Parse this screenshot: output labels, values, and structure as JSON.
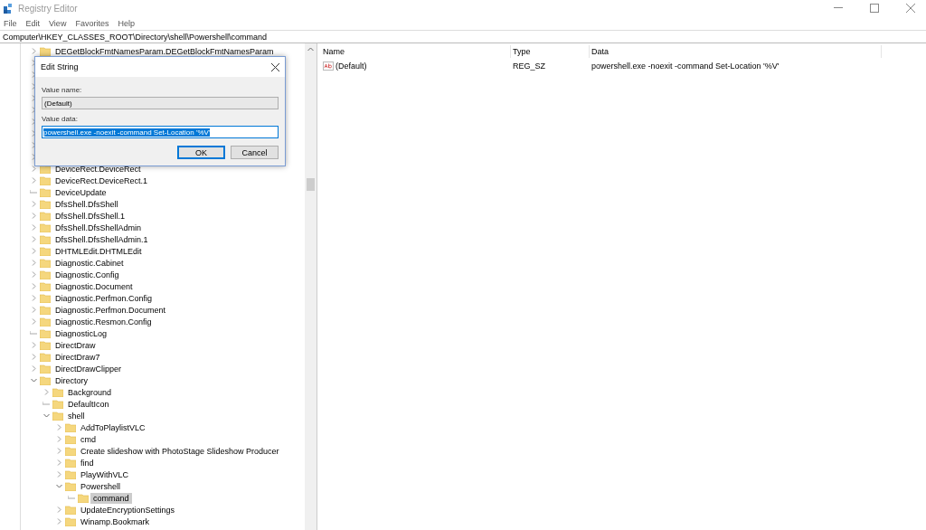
{
  "window": {
    "title": "Registry Editor"
  },
  "menu": [
    "File",
    "Edit",
    "View",
    "Favorites",
    "Help"
  ],
  "address": "Computer\\HKEY_CLASSES_ROOT\\Directory\\shell\\Powershell\\command",
  "tree": [
    {
      "label": "DEGetBlockFmtNamesParam.DEGetBlockFmtNamesParam",
      "kind": "collapsed",
      "selected": false
    },
    {
      "kind": "collapsed"
    },
    {
      "kind": "collapsed"
    },
    {
      "kind": "collapsed"
    },
    {
      "kind": "collapsed"
    },
    {
      "kind": "collapsed"
    },
    {
      "kind": "collapsed"
    },
    {
      "kind": "collapsed"
    },
    {
      "kind": "collapsed"
    },
    {
      "kind": "collapsed"
    },
    {
      "label": "DeviceRect.DeviceRect",
      "kind": "collapsed",
      "selected": false
    },
    {
      "label": "DeviceRect.DeviceRect.1",
      "kind": "collapsed",
      "selected": false
    },
    {
      "label": "DeviceUpdate",
      "kind": "leaf",
      "selected": false
    },
    {
      "label": "DfsShell.DfsShell",
      "kind": "collapsed",
      "selected": false
    },
    {
      "label": "DfsShell.DfsShell.1",
      "kind": "collapsed",
      "selected": false
    },
    {
      "label": "DfsShell.DfsShellAdmin",
      "kind": "collapsed",
      "selected": false
    },
    {
      "label": "DfsShell.DfsShellAdmin.1",
      "kind": "collapsed",
      "selected": false
    },
    {
      "label": "DHTMLEdit.DHTMLEdit",
      "kind": "collapsed",
      "selected": false
    },
    {
      "label": "Diagnostic.Cabinet",
      "kind": "collapsed",
      "selected": false
    },
    {
      "label": "Diagnostic.Config",
      "kind": "collapsed",
      "selected": false
    },
    {
      "label": "Diagnostic.Document",
      "kind": "collapsed",
      "selected": false
    },
    {
      "label": "Diagnostic.Perfmon.Config",
      "kind": "collapsed",
      "selected": false
    },
    {
      "label": "Diagnostic.Perfmon.Document",
      "kind": "collapsed",
      "selected": false
    },
    {
      "label": "Diagnostic.Resmon.Config",
      "kind": "collapsed",
      "selected": false
    },
    {
      "label": "DiagnosticLog",
      "kind": "leaf",
      "selected": false
    },
    {
      "label": "DirectDraw",
      "kind": "collapsed",
      "selected": false
    },
    {
      "label": "DirectDraw7",
      "kind": "collapsed",
      "selected": false
    },
    {
      "label": "DirectDrawClipper",
      "kind": "collapsed",
      "selected": false
    },
    {
      "label": "Directory",
      "kind": "expanded",
      "selected": false,
      "children": [
        {
          "label": "Background",
          "kind": "collapsed",
          "selected": false
        },
        {
          "label": "DefaultIcon",
          "kind": "leaf",
          "selected": false
        },
        {
          "label": "shell",
          "kind": "expanded",
          "selected": false,
          "children": [
            {
              "label": "AddToPlaylistVLC",
              "kind": "collapsed",
              "selected": false
            },
            {
              "label": "cmd",
              "kind": "collapsed",
              "selected": false
            },
            {
              "label": "Create slideshow with PhotoStage Slideshow Producer",
              "kind": "collapsed",
              "selected": false
            },
            {
              "label": "find",
              "kind": "collapsed",
              "selected": false
            },
            {
              "label": "PlayWithVLC",
              "kind": "collapsed",
              "selected": false
            },
            {
              "label": "Powershell",
              "kind": "expanded",
              "selected": false,
              "children": [
                {
                  "label": "command",
                  "kind": "leaf",
                  "selected": true
                }
              ]
            },
            {
              "label": "UpdateEncryptionSettings",
              "kind": "collapsed",
              "selected": false
            },
            {
              "label": "Winamp.Bookmark",
              "kind": "collapsed",
              "selected": false
            }
          ]
        }
      ]
    }
  ],
  "values": {
    "columns": [
      "Name",
      "Type",
      "Data"
    ],
    "rows": [
      {
        "name": "(Default)",
        "type": "REG_SZ",
        "data": "powershell.exe -noexit -command Set-Location '%V'"
      }
    ]
  },
  "dialog": {
    "title": "Edit String",
    "name_label": "Value name:",
    "name_value": "(Default)",
    "data_label": "Value data:",
    "data_value": "powershell.exe -noexit -command Set-Location '%V'",
    "buttons": [
      {
        "label": "OK",
        "default": true
      },
      {
        "label": "Cancel",
        "default": false
      }
    ]
  }
}
